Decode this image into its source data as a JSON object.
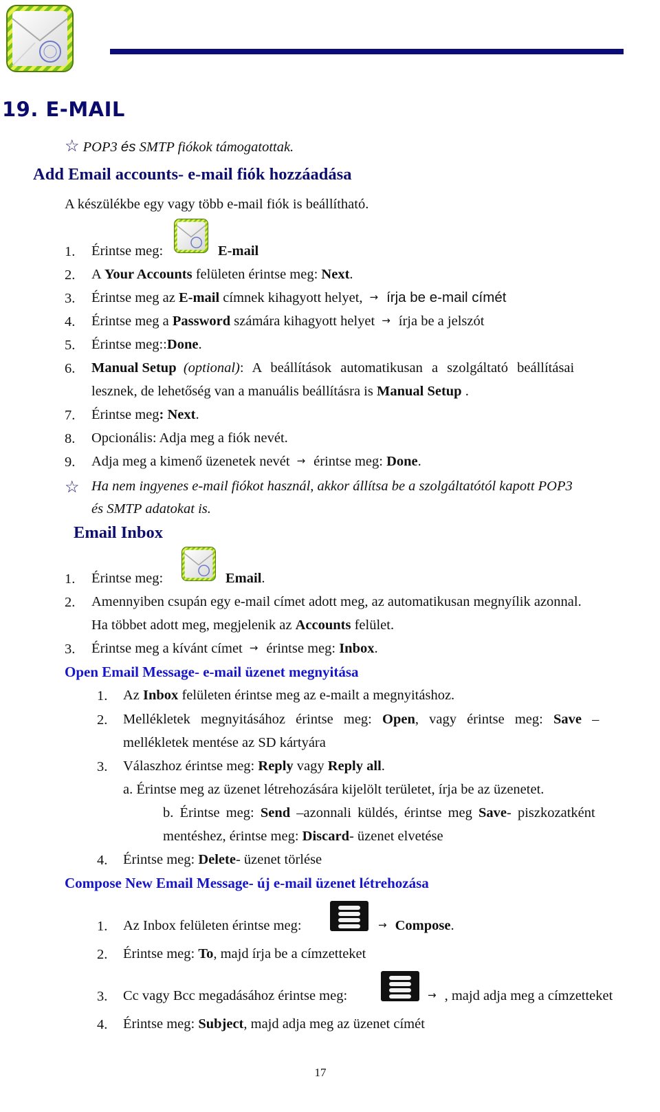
{
  "header": {
    "logo_icon": "email-app-icon",
    "chapter_title": "19. E-MAIL"
  },
  "intro_note": {
    "icon": "star-outline-icon",
    "part1": "POP3 ",
    "part2": "és",
    "part3": " SMTP fiókok támogatottak."
  },
  "add_accounts": {
    "heading": "Add Email accounts- e-mail fiók hozzáadása",
    "intro": "A készülékbe egy vagy több e-mail fiók is beállítható.",
    "steps": [
      {
        "num": "1.",
        "text1": "Érintse meg:",
        "icon": "email-app-icon",
        "bold1": "E-mail"
      },
      {
        "num": "2.",
        "text1": "A ",
        "bold1": "Your Accounts",
        "text2": " felületen érintse meg: ",
        "bold2": "Next",
        "text3": "."
      },
      {
        "num": "3.",
        "text1": "Érintse meg az ",
        "bold1": "E-mail",
        "text2": " címnek kihagyott helyet,",
        "arrow": "→",
        "text3": "írja be e-mail címét"
      },
      {
        "num": "4.",
        "text1": "Érintse meg a ",
        "bold1": "Password",
        "text2": " számára kihagyott helyet",
        "arrow": "→",
        "text3": "írja be a jelszót"
      },
      {
        "num": "5.",
        "text1": "Érintse meg::",
        "bold1": "Done",
        "text2": "."
      },
      {
        "num": "6.",
        "bold1": "Manual Setup",
        "italic1": "(optional)",
        "text1": ": A beállítások automatikusan a szolgáltató beállításai",
        "cont1": "lesznek, de lehetőség van a manuális beállításra is ",
        "cont_bold": "Manual Setup",
        "cont2": " ."
      },
      {
        "num": "7.",
        "text1": "Érintse meg",
        "bold1": ": Next",
        "text2": "."
      },
      {
        "num": "8.",
        "text1": "Opcionális: Adja meg a fiók nevét."
      },
      {
        "num": "9.",
        "text1": "Adja meg a kimenő üzenetek nevét",
        "arrow": "→",
        "text2": "érintse meg: ",
        "bold1": "Done",
        "text3": "."
      }
    ],
    "note_icon": "star-outline-icon",
    "note_line1": "Ha nem ingyenes e-mail fiókot használ, akkor állítsa be a szolgáltatótól kapott POP3",
    "note_line2": "és SMTP adatokat is."
  },
  "inbox": {
    "heading": "Email Inbox",
    "steps": [
      {
        "num": "1.",
        "text1": "Érintse meg:",
        "icon": "email-app-icon",
        "bold1": "Email",
        "text2": "."
      },
      {
        "num": "2.",
        "text1": "Amennyiben csupán egy e-mail címet adott meg, az automatikusan megnyílik azonnal.",
        "cont1": "Ha többet adott meg, megjelenik az ",
        "cont_bold": "Accounts",
        "cont2": " felület."
      },
      {
        "num": "3.",
        "text1": "Érintse meg a kívánt címet",
        "arrow": "→",
        "text2": "érintse meg: ",
        "bold1": "Inbox",
        "text3": "."
      }
    ]
  },
  "open_message": {
    "heading": "Open Email Message- e-mail üzenet megnyitása",
    "steps": [
      {
        "num": "1.",
        "text1": "Az ",
        "bold1": "Inbox",
        "text2": " felületen érintse meg az e-mailt a megnyitáshoz."
      },
      {
        "num": "2.",
        "text1": "Mellékletek megnyitásához érintse meg: ",
        "bold1": "Open",
        "text2": ", vagy érintse meg: ",
        "bold2": "Save",
        "text3": " –",
        "cont1": "mellékletek mentése az SD kártyára"
      },
      {
        "num": "3.",
        "text1": "Válaszhoz érintse meg: ",
        "bold1": "Reply",
        "text2": " vagy ",
        "bold2": "Reply all",
        "text3": "."
      },
      {
        "num": "4.",
        "text1": "Érintse meg: ",
        "bold1": "Delete",
        "text2": "- üzenet törlése"
      }
    ],
    "sub_a": "a. Érintse meg az üzenet létrehozására kijelölt területet, írja be az üzenetet.",
    "sub_b": {
      "text1": "b. Érintse meg: ",
      "bold1": "Send",
      "text2": " –azonnali küldés, érintse meg ",
      "bold2": "Save",
      "text3": "- piszkozatként",
      "cont1": "mentéshez, érintse meg: ",
      "cont_bold": "Discard",
      "cont2": "- üzenet elvetése"
    }
  },
  "compose": {
    "heading": "Compose New Email Message- új e-mail üzenet létrehozása",
    "steps": [
      {
        "num": "1.",
        "text1": "Az Inbox felületen érintse meg:",
        "icon": "menu-icon",
        "arrow": "→",
        "bold1": "Compose",
        "text2": "."
      },
      {
        "num": "2.",
        "text1": "Érintse meg: ",
        "bold1": "To",
        "text2": ", majd írja be a címzetteket"
      },
      {
        "num": "3.",
        "text1": "Cc vagy Bcc megadásához érintse meg:",
        "icon": "menu-icon",
        "arrow": "→",
        "text2": ", majd adja meg a címzetteket"
      },
      {
        "num": "4.",
        "text1": "Érintse meg: ",
        "bold1": "Subject",
        "text2": ", majd adja meg az üzenet címét"
      }
    ]
  },
  "footer": {
    "page_number": "17"
  },
  "colors": {
    "navy_heading": "#0e0e6e",
    "blue_heading": "#1616c8",
    "header_rule": "#0b0b7a"
  }
}
